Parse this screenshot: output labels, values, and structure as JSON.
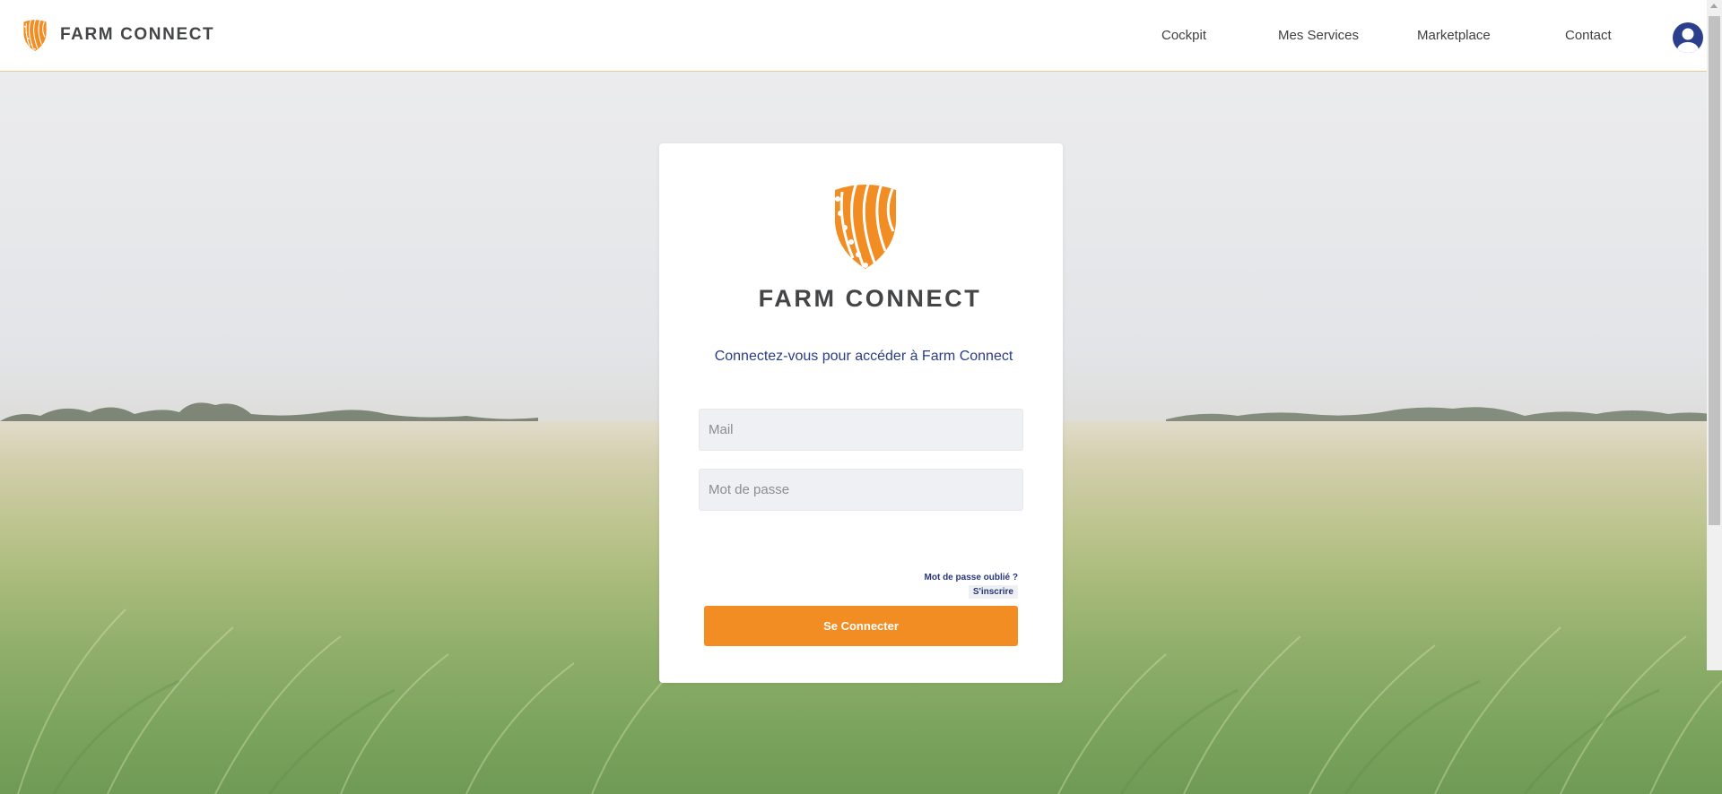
{
  "header": {
    "brand": "FARM CONNECT",
    "nav": [
      {
        "label": "Cockpit"
      },
      {
        "label": "Mes Services"
      },
      {
        "label": "Marketplace"
      },
      {
        "label": "Contact"
      }
    ],
    "avatar_icon": "user-avatar-icon"
  },
  "login": {
    "brand": "FARM CONNECT",
    "subtitle": "Connectez-vous pour accéder à Farm Connect",
    "mail_placeholder": "Mail",
    "password_placeholder": "Mot de passe",
    "forgot_label": "Mot de passe oublié ?",
    "signup_label": "S'inscrire",
    "submit_label": "Se Connecter"
  },
  "colors": {
    "accent": "#F18D22",
    "link": "#27357A",
    "subtitle": "#2A3D86",
    "brand_text": "#444547"
  }
}
